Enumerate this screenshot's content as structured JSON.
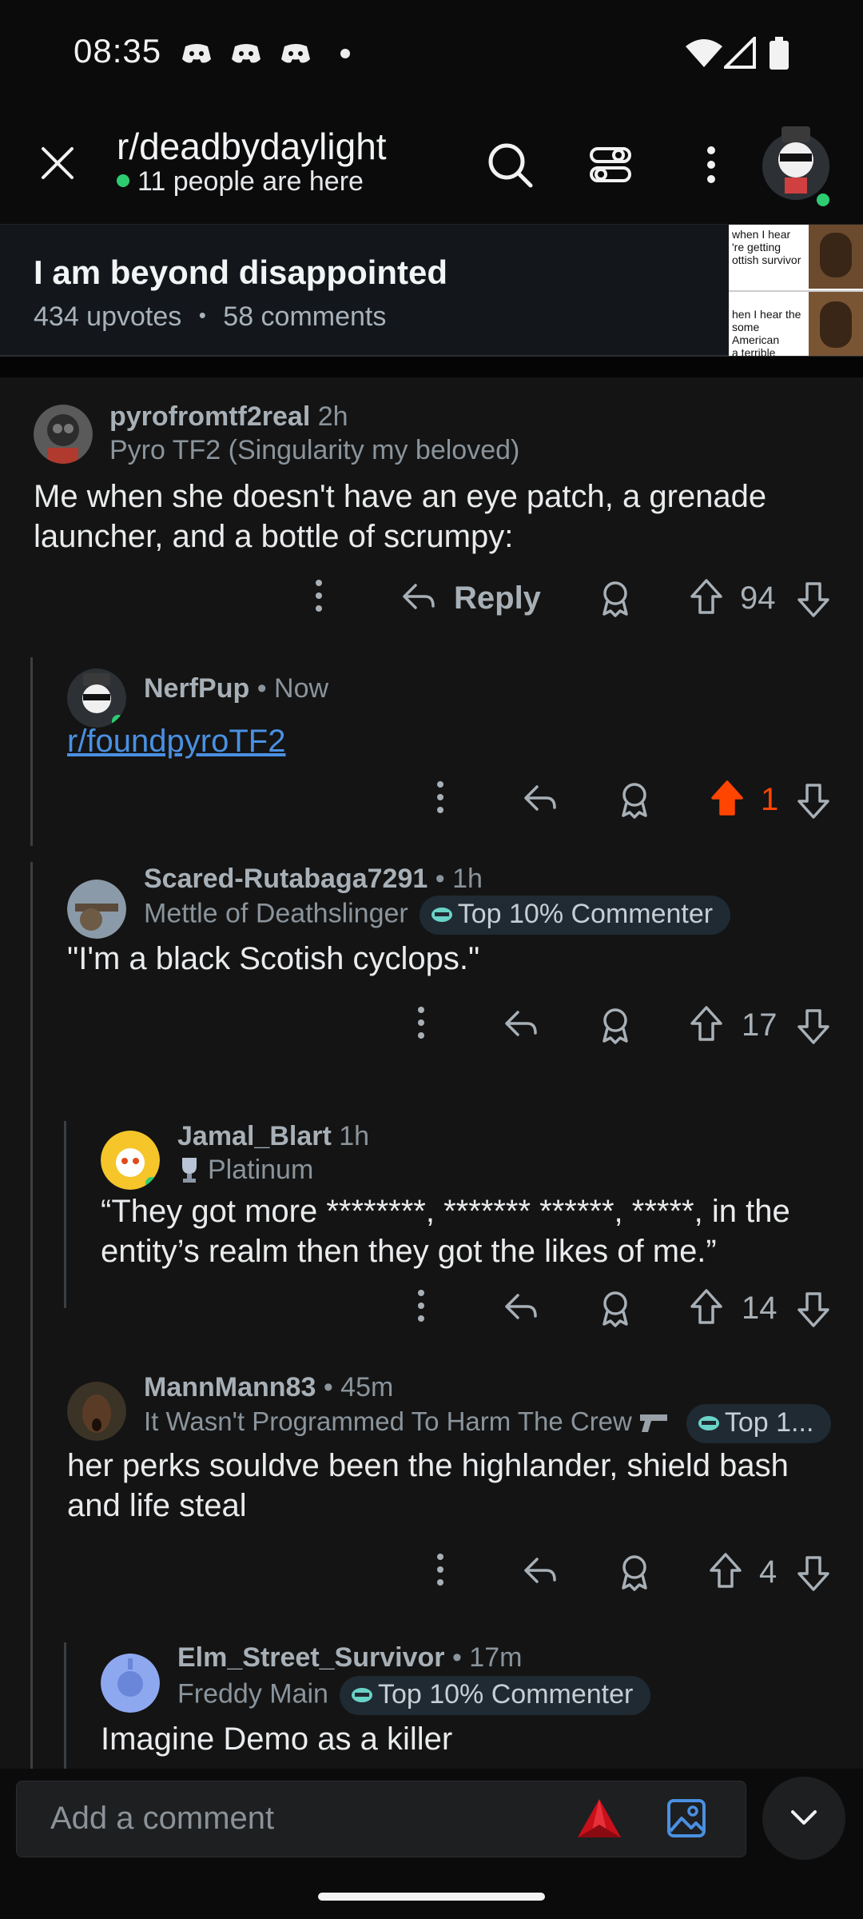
{
  "status_bar": {
    "time": "08:35"
  },
  "header": {
    "subreddit": "r/deadbydaylight",
    "online": "11 people are here"
  },
  "post": {
    "title": "I am beyond disappointed",
    "upvotes": "434 upvotes",
    "separator": "•",
    "comments": "58 comments",
    "thumb_top": [
      "when I hear",
      "'re getting",
      "ottish survivor"
    ],
    "thumb_bottom": [
      "hen I hear the",
      "some American",
      "a terrible accent"
    ]
  },
  "comments": [
    {
      "user": "pyrofromtf2real",
      "time": "2h",
      "flair": "Pyro TF2 (Singularity my beloved)",
      "text": "Me when she doesn't have an eye patch, a grenade launcher, and a bottle of scrumpy:",
      "reply_label": "Reply",
      "score": "94"
    },
    {
      "user": "NerfPup",
      "time": "• Now",
      "link": "r/foundpyroTF2",
      "score": "1"
    },
    {
      "user": "Scared-Rutabaga7291",
      "time": "• 1h",
      "flair": "Mettle of Deathslinger",
      "badge": "Top 10% Commenter",
      "text": "\"I'm a black Scotish cyclops.\"",
      "score": "17"
    },
    {
      "user": "Jamal_Blart",
      "time": "1h",
      "flair": "Platinum",
      "text": "“They got more ********, ******* ******, *****, in the entity’s realm then they got the likes of me.”",
      "score": "14"
    },
    {
      "user": "MannMann83",
      "time": "• 45m",
      "flair": "It Wasn't Programmed To Harm The Crew",
      "badge": "Top 1...",
      "text": "her perks souldve been the highlander, shield bash and life steal",
      "score": "4"
    },
    {
      "user": "Elm_Street_Survivor",
      "time": "• 17m",
      "flair": "Freddy Main",
      "badge": "Top 10% Commenter",
      "text": "Imagine Demo as a killer"
    }
  ],
  "composer": {
    "placeholder": "Add a comment"
  },
  "colors": {
    "upvoted": "#ff4500",
    "online_dot": "#2ecc71",
    "link": "#4a90e2",
    "badge_bg": "#1f2a33"
  }
}
